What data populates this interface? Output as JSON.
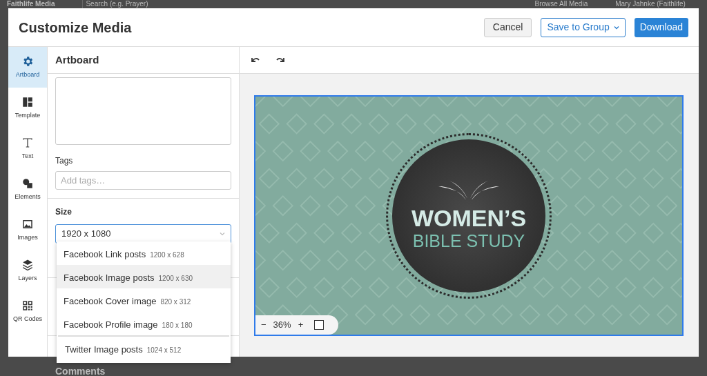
{
  "backdrop": {
    "brand": "Faithlife Media",
    "search_placeholder": "Search (e.g. Prayer)",
    "nav_link": "Browse All Media",
    "user": "Mary Jahnke (Faithlife)",
    "section_heading": "Comments"
  },
  "dialog": {
    "title": "Customize Media",
    "buttons": [
      {
        "label": "Cancel",
        "kind": "secondary"
      },
      {
        "label": "Save to Group",
        "kind": "dropdown"
      },
      {
        "label": "Download",
        "kind": "primary"
      }
    ]
  },
  "rail": [
    {
      "label": "Artboard",
      "kind": "gear",
      "selected": true
    },
    {
      "label": "Template",
      "kind": "template",
      "selected": false
    },
    {
      "label": "Text",
      "kind": "text",
      "selected": false
    },
    {
      "label": "Elements",
      "kind": "shapes",
      "selected": false
    },
    {
      "label": "Images",
      "kind": "image",
      "selected": false
    },
    {
      "label": "Layers",
      "kind": "layers",
      "selected": false
    },
    {
      "label": "QR Codes",
      "kind": "qr",
      "selected": false
    }
  ],
  "panel": {
    "title": "Artboard",
    "tags_label": "Tags",
    "tags_placeholder": "Add tags…",
    "size_label": "Size",
    "size_value": "1920 x 1080",
    "size_options": [
      {
        "name": "Facebook Link posts",
        "dimensions": "1200 x 628",
        "selected": false,
        "separator_before": false
      },
      {
        "name": "Facebook Image posts",
        "dimensions": "1200 x 630",
        "selected": true,
        "separator_before": false
      },
      {
        "name": "Facebook Cover image",
        "dimensions": "820 x 312",
        "selected": false,
        "separator_before": false
      },
      {
        "name": "Facebook Profile image",
        "dimensions": "180 x 180",
        "selected": false,
        "separator_before": false
      },
      {
        "name": "Twitter Image posts",
        "dimensions": "1024 x 512",
        "selected": false,
        "separator_before": true
      }
    ]
  },
  "canvas": {
    "zoom_out": "−",
    "zoom": "36%",
    "zoom_in": "+",
    "artwork": {
      "title": "WOMEN’S",
      "subtitle": "BIBLE STUDY"
    }
  }
}
